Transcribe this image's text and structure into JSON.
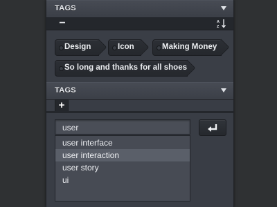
{
  "panel": {
    "section1": {
      "title": "TAGS"
    },
    "toolbar": {
      "remove_label": "−"
    },
    "tags": [
      {
        "label": "Design"
      },
      {
        "label": "Icon"
      },
      {
        "label": "Making Money"
      },
      {
        "label": "So long and thanks for all shoes"
      }
    ],
    "section2": {
      "title": "TAGS"
    },
    "add_tab_label": "+",
    "input": {
      "value": "user"
    },
    "suggestions": [
      {
        "label": "user interface"
      },
      {
        "label": "user interaction"
      },
      {
        "label": "user story"
      },
      {
        "label": "ui"
      }
    ]
  }
}
